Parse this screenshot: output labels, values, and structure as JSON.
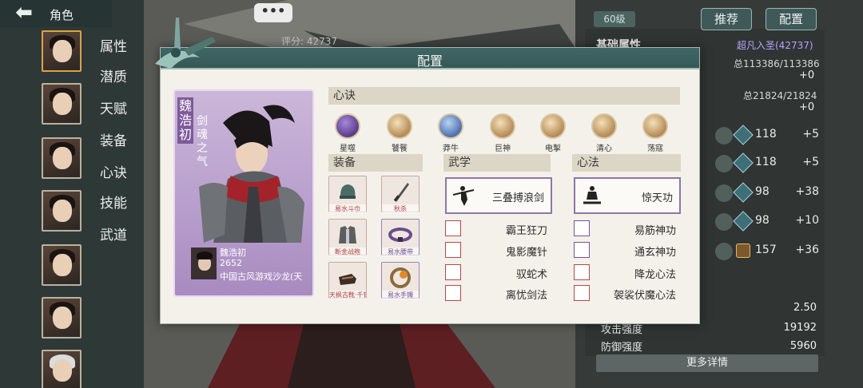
{
  "nav": {
    "back_icon": "arrow-left-icon",
    "title": "角色",
    "tabs": [
      "属性",
      "潜质",
      "天赋",
      "装备",
      "心诀",
      "技能",
      "武道"
    ]
  },
  "header": {
    "chat_dots": "•••",
    "score": "评分: 42737",
    "level": "60级",
    "recommend_label": "推荐",
    "config_label": "配置"
  },
  "right_panel": {
    "title": "基础属性",
    "rank": "超凡入圣(42737)",
    "total1": "总113386/113386",
    "plus1": "+0",
    "total2": "总21824/21824",
    "plus2": "+0",
    "stats": [
      {
        "value": "118",
        "plus": "+5"
      },
      {
        "value": "118",
        "plus": "+5"
      },
      {
        "value": "98",
        "plus": "+38"
      },
      {
        "value": "98",
        "plus": "+10"
      },
      {
        "value": "157",
        "plus": "+36"
      }
    ],
    "bottom_value": "2.50",
    "attack_label": "攻击强度",
    "attack_value": "19192",
    "defense_label": "防御强度",
    "defense_value": "5960",
    "more_details": "更多详情"
  },
  "modal": {
    "title": "配置",
    "card": {
      "name": "魏浩初",
      "subtitle": "剑魂之气",
      "info_name": "魏浩初",
      "info_number": "2652",
      "info_guild": "中国古风游戏沙龙(天"
    },
    "xinjue_header": "心诀",
    "xinjue": [
      {
        "label": "星噬",
        "color": "#5b3c8c"
      },
      {
        "label": "饕餮",
        "color": "#b58a55"
      },
      {
        "label": "莽牛",
        "color": "#4d6fae"
      },
      {
        "label": "巨神",
        "color": "#b58a55"
      },
      {
        "label": "电掣",
        "color": "#b58a55"
      },
      {
        "label": "清心",
        "color": "#b58a55"
      },
      {
        "label": "荡寇",
        "color": "#b58a55"
      }
    ],
    "equip_header": "装备",
    "equipment": [
      {
        "label": "易水斗巾",
        "kind": "red"
      },
      {
        "label": "秋杀",
        "kind": "red"
      },
      {
        "label": "断金战袍",
        "kind": "red"
      },
      {
        "label": "易水腰带",
        "kind": "purple"
      },
      {
        "label": "天枫古靴·千钧",
        "kind": "red"
      },
      {
        "label": "易水手镯",
        "kind": "purple"
      }
    ],
    "wuxue_header": "武学",
    "wuxue_main": "三叠搏浪剑",
    "wuxue_list": [
      "霸王狂刀",
      "鬼影魔针",
      "驭蛇术",
      "离忧剑法"
    ],
    "xinfa_header": "心法",
    "xinfa_main": "惊天功",
    "xinfa_list": [
      "易筋神功",
      "通玄神功",
      "降龙心法",
      "袈裟伏魔心法"
    ]
  }
}
